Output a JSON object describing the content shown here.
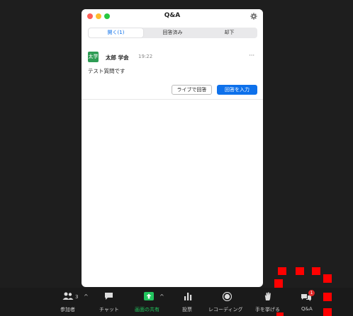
{
  "window": {
    "title": "Q&A",
    "tabs": [
      {
        "label": "開く(1)",
        "active": true
      },
      {
        "label": "回答済み",
        "active": false
      },
      {
        "label": "却下",
        "active": false
      }
    ]
  },
  "question": {
    "avatar_text": "太学",
    "author": "太郎 学会",
    "time": "19:22",
    "more": "···",
    "text": "テスト質問です",
    "answer_live_label": "ライブで回答",
    "type_answer_label": "回答を入力"
  },
  "toolbar": {
    "participants": {
      "label": "参加者",
      "count": "3"
    },
    "chat": {
      "label": "チャット"
    },
    "share_screen": {
      "label": "画面の共有"
    },
    "polls": {
      "label": "投票"
    },
    "recording": {
      "label": "レコーディング"
    },
    "raise_hand": {
      "label": "手を挙げる"
    },
    "qa": {
      "label": "Q&A",
      "badge": "1"
    }
  },
  "colors": {
    "accent": "#0e71eb",
    "share_green": "#22c55e",
    "background": "#1e1e1e",
    "marker": "#ff0000"
  }
}
